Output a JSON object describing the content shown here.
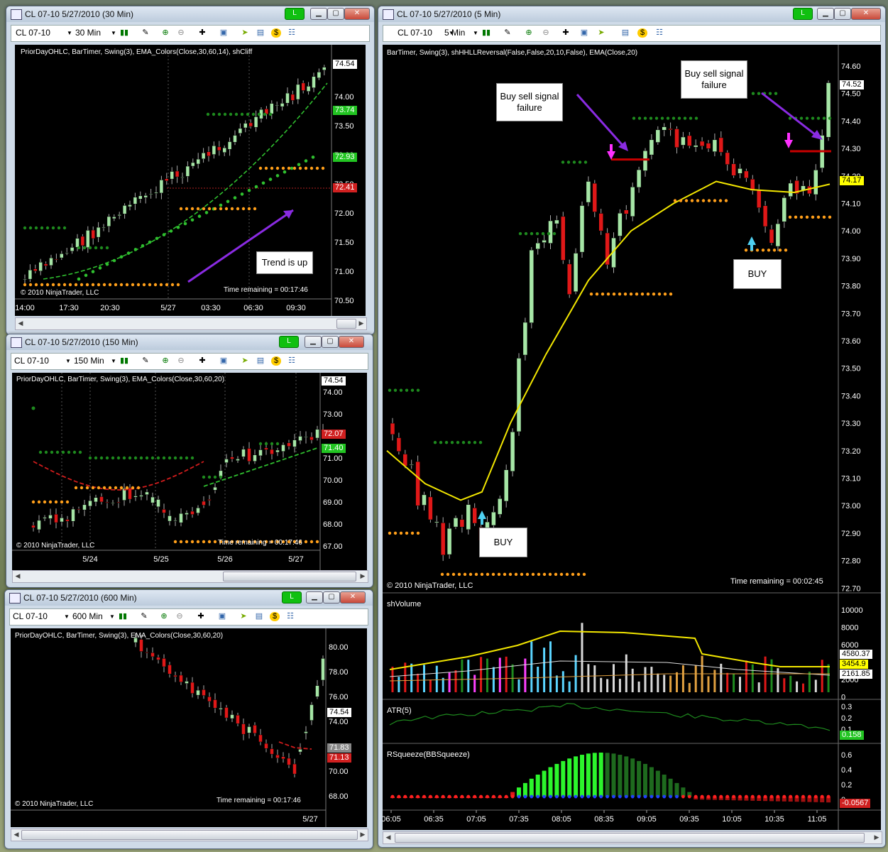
{
  "w1": {
    "title": "CL 07-10  5/27/2010 (30 Min)",
    "instrument": "CL 07-10",
    "interval": "30 Min",
    "indicators": "PriorDayOHLC, BarTimer, Swing(3), EMA_Colors(Close,30,60,14), shCliff",
    "copyright": "© 2010 NinjaTrader, LLC",
    "time_remaining": "Time remaining = 00:17:46",
    "annotation": "Trend is up",
    "yticks": [
      "74.00",
      "73.50",
      "73.00",
      "72.50",
      "72.00",
      "71.50",
      "71.00",
      "70.50"
    ],
    "xticks": [
      "14:00",
      "17:30",
      "20:30",
      "5/27",
      "03:30",
      "06:30",
      "09:30"
    ],
    "price_tags": [
      {
        "v": "74.54",
        "c": "#ffffff"
      },
      {
        "v": "73.74",
        "c": "#22c422"
      },
      {
        "v": "72.93",
        "c": "#22c422"
      },
      {
        "v": "72.41",
        "c": "#d02020"
      }
    ]
  },
  "w2": {
    "title": "CL 07-10  5/27/2010 (150 Min)",
    "instrument": "CL 07-10",
    "interval": "150 Min",
    "indicators": "PriorDayOHLC, BarTimer, Swing(3), EMA_Colors(Close,30,60,20)",
    "copyright": "© 2010 NinjaTrader, LLC",
    "time_remaining": "Time remaining = 00:17:46",
    "yticks": [
      "74.00",
      "73.00",
      "72.00",
      "71.00",
      "70.00",
      "69.00",
      "68.00",
      "67.00"
    ],
    "xticks": [
      "5/24",
      "5/25",
      "5/26",
      "5/27"
    ],
    "price_tags": [
      {
        "v": "74.54",
        "c": "#ffffff"
      },
      {
        "v": "72.07",
        "c": "#d02020"
      },
      {
        "v": "71.40",
        "c": "#22c422"
      }
    ]
  },
  "w3": {
    "title": "CL 07-10  5/27/2010 (600 Min)",
    "instrument": "CL 07-10",
    "interval": "600 Min",
    "indicators": "PriorDayOHLC, BarTimer, Swing(3), EMA_Colors(Close,30,60,20)",
    "copyright": "© 2010 NinjaTrader, LLC",
    "time_remaining": "Time remaining = 00:17:46",
    "yticks": [
      "80.00",
      "78.00",
      "76.00",
      "74.00",
      "72.00",
      "70.00",
      "68.00"
    ],
    "xticks": [
      "5/27"
    ],
    "price_tags": [
      {
        "v": "74.54",
        "c": "#ffffff"
      },
      {
        "v": "71.83",
        "c": "#888888"
      },
      {
        "v": "71.13",
        "c": "#d02020"
      }
    ]
  },
  "w4": {
    "title": "CL 07-10  5/27/2010 (5 Min)",
    "instrument": "CL 07-10",
    "interval": "5 Min",
    "indicators": "BarTimer, Swing(3), shHHLLReversal(False,False,20,10,False), EMA(Close,20)",
    "copyright": "© 2010 NinjaTrader, LLC",
    "time_remaining": "Time remaining = 00:02:45",
    "annotations": [
      "Buy sell signal failure",
      "Buy sell signal failure",
      "BUY",
      "BUY"
    ],
    "yticks": [
      "74.60",
      "74.50",
      "74.40",
      "74.30",
      "74.20",
      "74.10",
      "74.00",
      "73.90",
      "73.80",
      "73.70",
      "73.60",
      "73.50",
      "73.40",
      "73.30",
      "73.20",
      "73.10",
      "73.00",
      "72.90",
      "72.80",
      "72.70"
    ],
    "price_tags": [
      {
        "v": "74.52",
        "c": "#ffffff"
      },
      {
        "v": "74.17",
        "c": "#ffff00"
      }
    ],
    "xticks": [
      "06:05",
      "06:35",
      "07:05",
      "07:35",
      "08:05",
      "08:35",
      "09:05",
      "09:35",
      "10:05",
      "10:35",
      "11:05"
    ],
    "volume": {
      "label": "shVolume",
      "yticks": [
        "10000",
        "8000",
        "6000",
        "4000",
        "2000",
        "0"
      ],
      "tags": [
        {
          "v": "4580.37",
          "c": "#ffffff"
        },
        {
          "v": "3454.9",
          "c": "#ffff00"
        },
        {
          "v": "2161.85",
          "c": "#ffffff"
        }
      ]
    },
    "atr": {
      "label": "ATR(5)",
      "yticks": [
        "0.3",
        "0.2",
        "0.1"
      ],
      "tag": "0.158"
    },
    "rsq": {
      "label": "RSqueeze(BBSqueeze)",
      "yticks": [
        "0.6",
        "0.4",
        "0.2",
        "0"
      ],
      "tag": "-0.0567"
    }
  }
}
